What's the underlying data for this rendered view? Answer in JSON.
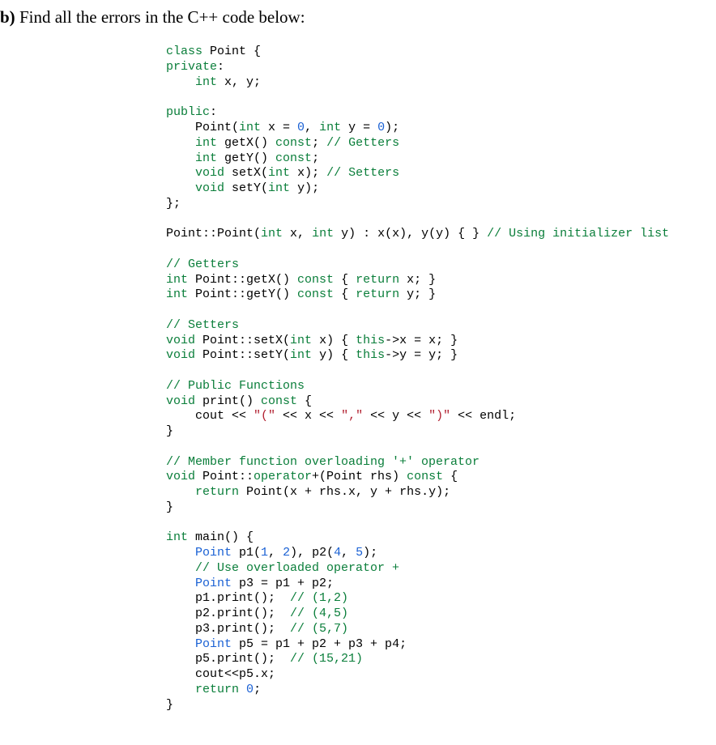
{
  "question": {
    "label": "b)",
    "text": " Find all the errors in the C++ code below:"
  },
  "code": {
    "l01a": "class",
    "l01b": " Point {",
    "l02a": "private",
    "l02b": ":",
    "l03a": "    ",
    "l03b": "int",
    "l03c": " x, y;",
    "l04": "",
    "l05a": "public",
    "l05b": ":",
    "l06a": "    Point(",
    "l06b": "int",
    "l06c": " x = ",
    "l06d": "0",
    "l06e": ", ",
    "l06f": "int",
    "l06g": " y = ",
    "l06h": "0",
    "l06i": ");",
    "l07a": "    ",
    "l07b": "int",
    "l07c": " getX() ",
    "l07d": "const",
    "l07e": "; ",
    "l07f": "// Getters",
    "l08a": "    ",
    "l08b": "int",
    "l08c": " getY() ",
    "l08d": "const",
    "l08e": ";",
    "l09a": "    ",
    "l09b": "void",
    "l09c": " setX(",
    "l09d": "int",
    "l09e": " x); ",
    "l09f": "// Setters",
    "l10a": "    ",
    "l10b": "void",
    "l10c": " setY(",
    "l10d": "int",
    "l10e": " y);",
    "l11": "};",
    "l12": "",
    "l13a": "Point::Point(",
    "l13b": "int",
    "l13c": " x, ",
    "l13d": "int",
    "l13e": " y) : x(x), y(y) { } ",
    "l13f": "// Using initializer list",
    "l14": "",
    "l15": "// Getters",
    "l16a": "int",
    "l16b": " Point::getX() ",
    "l16c": "const",
    "l16d": " { ",
    "l16e": "return",
    "l16f": " x; }",
    "l17a": "int",
    "l17b": " Point::getY() ",
    "l17c": "const",
    "l17d": " { ",
    "l17e": "return",
    "l17f": " y; }",
    "l18": "",
    "l19": "// Setters",
    "l20a": "void",
    "l20b": " Point::setX(",
    "l20c": "int",
    "l20d": " x) { ",
    "l20e": "this",
    "l20f": "->x = x; }",
    "l21a": "void",
    "l21b": " Point::setY(",
    "l21c": "int",
    "l21d": " y) { ",
    "l21e": "this",
    "l21f": "->y = y; }",
    "l22": "",
    "l23": "// Public Functions",
    "l24a": "void",
    "l24b": " print() ",
    "l24c": "const",
    "l24d": " {",
    "l25a": "    cout << ",
    "l25b": "\"(\"",
    "l25c": " << x << ",
    "l25d": "\",\"",
    "l25e": " << y << ",
    "l25f": "\")\"",
    "l25g": " << endl;",
    "l26": "}",
    "l27": "",
    "l28": "// Member function overloading '+' operator",
    "l29a": "void",
    "l29b": " Point::",
    "l29c": "operator",
    "l29d": "+(Point rhs) ",
    "l29e": "const",
    "l29f": " {",
    "l30a": "    ",
    "l30b": "return",
    "l30c": " Point(x + rhs.x, y + rhs.y);",
    "l31": "}",
    "l32": "",
    "l33a": "int",
    "l33b": " main() {",
    "l34a": "    ",
    "l34b": "Point",
    "l34c": " p1(",
    "l34d": "1",
    "l34e": ", ",
    "l34f": "2",
    "l34g": "), p2(",
    "l34h": "4",
    "l34i": ", ",
    "l34j": "5",
    "l34k": ");",
    "l35a": "    ",
    "l35b": "// Use overloaded operator +",
    "l36a": "    ",
    "l36b": "Point",
    "l36c": " p3 = p1 + p2;",
    "l37a": "    p1.print();  ",
    "l37b": "// (1,2)",
    "l38a": "    p2.print();  ",
    "l38b": "// (4,5)",
    "l39a": "    p3.print();  ",
    "l39b": "// (5,7)",
    "l40a": "    ",
    "l40b": "Point",
    "l40c": " p5 = p1 + p2 + p3 + p4;",
    "l41a": "    p5.print();  ",
    "l41b": "// (15,21)",
    "l42": "    cout<<p5.x;",
    "l43a": "    ",
    "l43b": "return",
    "l43c": " ",
    "l43d": "0",
    "l43e": ";",
    "l44": "}"
  }
}
